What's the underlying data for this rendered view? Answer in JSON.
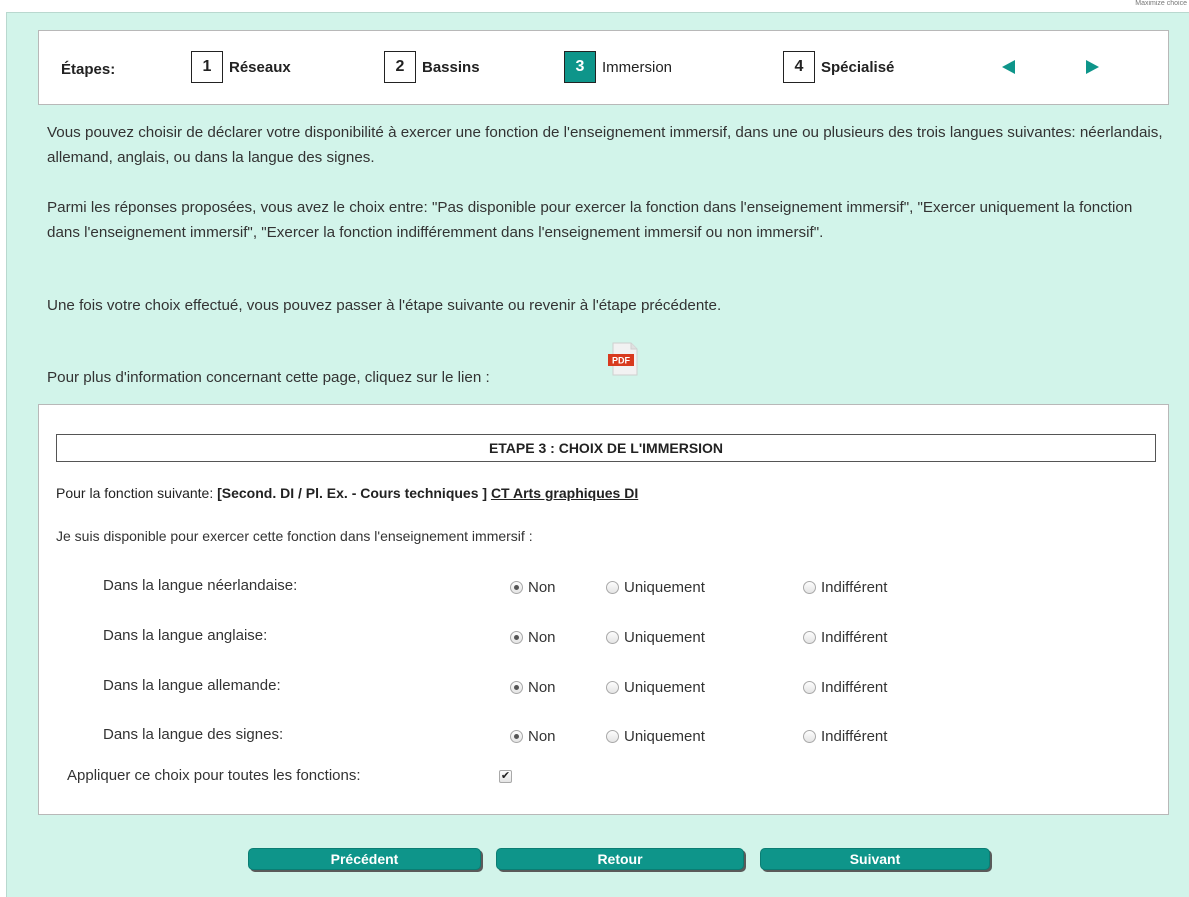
{
  "corner_text": "Maximize choice",
  "steps": {
    "label": "Étapes:",
    "items": [
      {
        "num": "1",
        "label": "Réseaux"
      },
      {
        "num": "2",
        "label": "Bassins"
      },
      {
        "num": "3",
        "label": "Immersion",
        "active": true
      },
      {
        "num": "4",
        "label": "Spécialisé"
      }
    ]
  },
  "intro": {
    "p1": "Vous pouvez choisir de déclarer votre disponibilité à exercer une fonction de l'enseignement immersif, dans une ou plusieurs des trois langues suivantes: néerlandais, allemand, anglais, ou dans la langue des signes.",
    "p2": "Parmi les réponses proposées, vous avez le choix entre: \"Pas disponible pour exercer la fonction dans l'enseignement immersif\", \"Exercer uniquement la fonction dans l'enseignement immersif\", \"Exercer la fonction indifféremment dans l'enseignement immersif ou non immersif\".",
    "p3": "Une fois votre choix effectué, vous pouvez passer à l'étape suivante ou revenir à l'étape précédente.",
    "p4": "Pour plus d'information concernant cette page, cliquez sur le lien :",
    "pdf_label": "PDF"
  },
  "panel": {
    "title": "ETAPE 3 : CHOIX DE L'IMMERSION",
    "fn_prefix": "Pour la fonction suivante: ",
    "fn_category": "[Second. DI / Pl. Ex. - Cours techniques ]",
    "fn_link": "CT Arts graphiques DI",
    "dispo": "Je suis disponible pour exercer cette fonction dans l'enseignement immersif :",
    "options": {
      "non": "Non",
      "uni": "Uniquement",
      "ind": "Indifférent"
    },
    "rows": [
      {
        "label": "Dans la langue néerlandaise:",
        "selected": "non"
      },
      {
        "label": "Dans la langue anglaise:",
        "selected": "non"
      },
      {
        "label": "Dans la langue allemande:",
        "selected": "non"
      },
      {
        "label": "Dans la langue des signes:",
        "selected": "non"
      }
    ],
    "apply_label": "Appliquer ce choix pour toutes les fonctions:",
    "apply_checked": true
  },
  "buttons": {
    "prev": "Précédent",
    "back": "Retour",
    "next": "Suivant"
  },
  "colors": {
    "accent": "#0e958a",
    "background": "#d2f4ea"
  }
}
